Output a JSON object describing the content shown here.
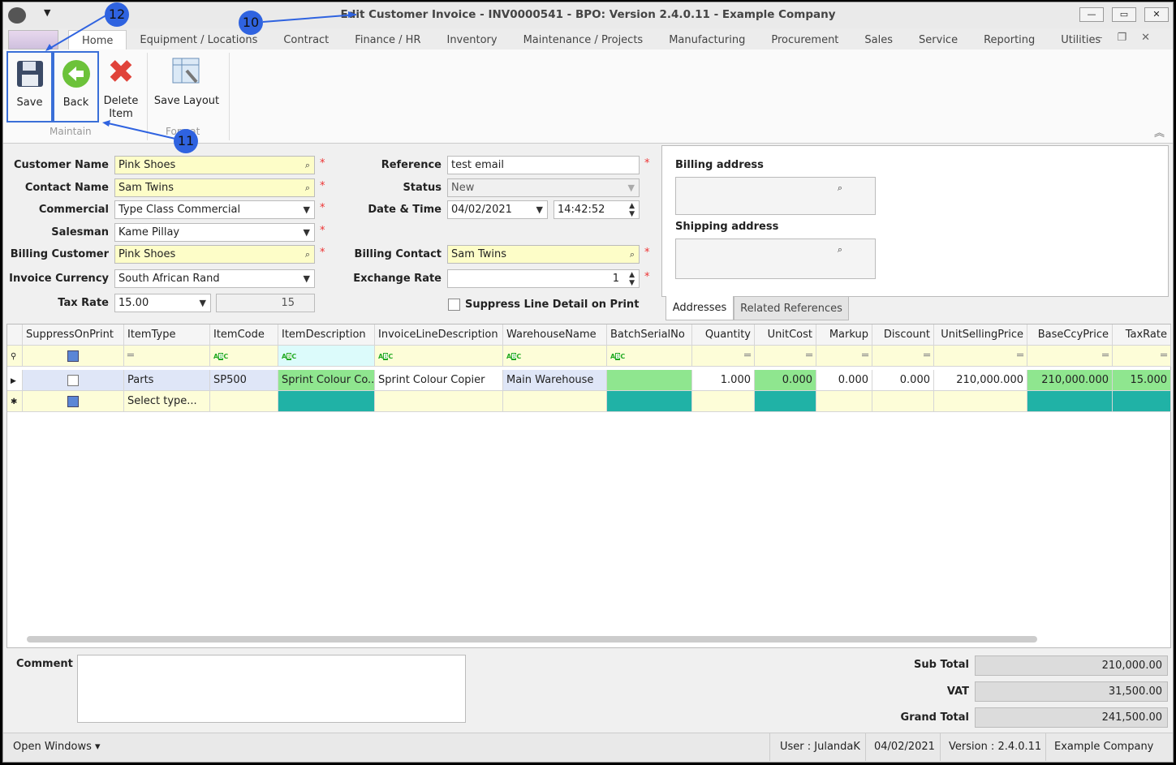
{
  "window": {
    "title": "Edit Customer Invoice - INV0000541 - BPO: Version 2.4.0.11 - Example Company"
  },
  "tabs": [
    "Home",
    "Equipment / Locations",
    "Contract",
    "Finance / HR",
    "Inventory",
    "Maintenance / Projects",
    "Manufacturing",
    "Procurement",
    "Sales",
    "Service",
    "Reporting",
    "Utilities"
  ],
  "ribbon": {
    "save": "Save",
    "back": "Back",
    "delete": "Delete Item",
    "save_layout": "Save Layout",
    "group_maintain": "Maintain",
    "group_format": "Format"
  },
  "callouts": [
    "10",
    "11",
    "12"
  ],
  "form": {
    "customer_name": {
      "label": "Customer Name",
      "value": "Pink Shoes"
    },
    "contact_name": {
      "label": "Contact Name",
      "value": "Sam Twins"
    },
    "commercial": {
      "label": "Commercial",
      "value": "Type Class Commercial"
    },
    "salesman": {
      "label": "Salesman",
      "value": "Kame Pillay"
    },
    "billing_customer": {
      "label": "Billing Customer",
      "value": "Pink Shoes"
    },
    "invoice_currency": {
      "label": "Invoice Currency",
      "value": "South African Rand"
    },
    "tax_rate": {
      "label": "Tax Rate",
      "value": "15.00",
      "value2": "15"
    },
    "reference": {
      "label": "Reference",
      "value": "test email"
    },
    "status": {
      "label": "Status",
      "value": "New"
    },
    "date_time": {
      "label": "Date & Time",
      "date": "04/02/2021",
      "time": "14:42:52"
    },
    "billing_contact": {
      "label": "Billing Contact",
      "value": "Sam Twins"
    },
    "exchange_rate": {
      "label": "Exchange Rate",
      "value": "1"
    },
    "suppress": {
      "label": "Suppress Line Detail on Print",
      "checked": false
    }
  },
  "address": {
    "billing_label": "Billing address",
    "shipping_label": "Shipping address",
    "tabs": [
      "Addresses",
      "Related References"
    ]
  },
  "grid": {
    "columns": [
      "SuppressOnPrint",
      "ItemType",
      "ItemCode",
      "ItemDescription",
      "InvoiceLineDescription",
      "WarehouseName",
      "BatchSerialNo",
      "Quantity",
      "UnitCost",
      "Markup",
      "Discount",
      "UnitSellingPrice",
      "BaseCcyPrice",
      "TaxRate"
    ],
    "rows": [
      [
        "",
        "Parts",
        "SP500",
        "Sprint Colour Co...",
        "Sprint Colour Copier",
        "Main Warehouse",
        "",
        "1.000",
        "0.000",
        "0.000",
        "0.000",
        "210,000.000",
        "210,000.000",
        "15.000"
      ]
    ],
    "new_row_placeholder": "Select type..."
  },
  "bottom": {
    "comment_label": "Comment",
    "comment": "",
    "sub_total_label": "Sub Total",
    "sub_total": "210,000.00",
    "vat_label": "VAT",
    "vat": "31,500.00",
    "grand_total_label": "Grand Total",
    "grand_total": "241,500.00"
  },
  "status": {
    "open_windows": "Open Windows",
    "user": "User : JulandaK",
    "date": "04/02/2021",
    "version": "Version : 2.4.0.11",
    "company": "Example Company"
  }
}
